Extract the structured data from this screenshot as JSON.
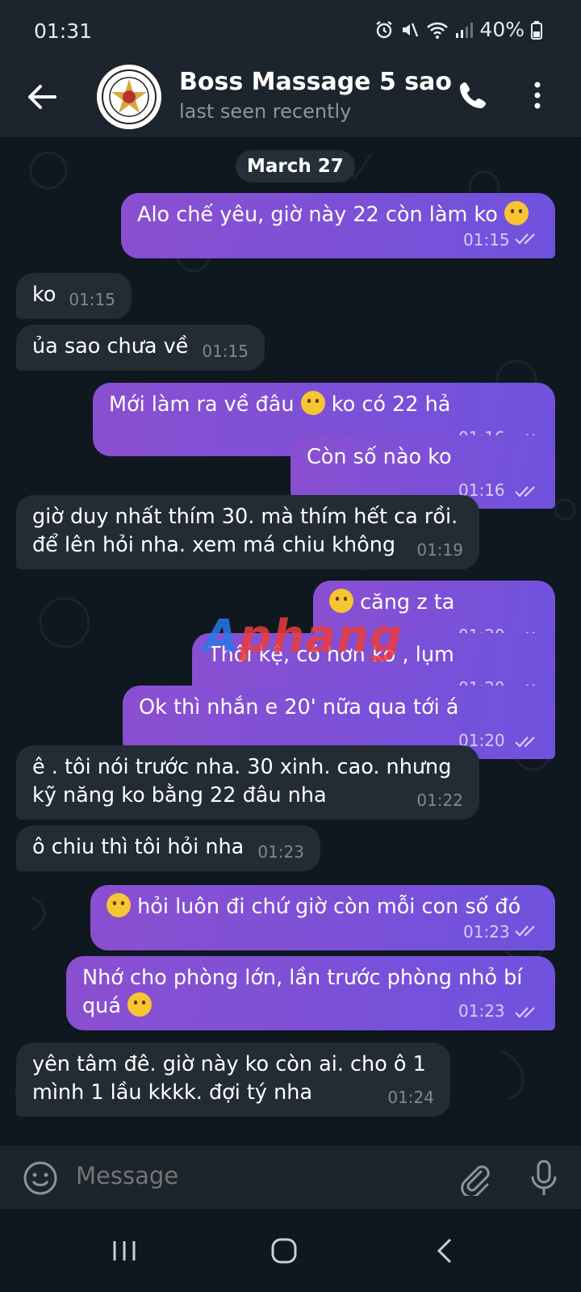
{
  "status": {
    "time": "01:31",
    "battery": "40%"
  },
  "header": {
    "title": "Boss Massage 5 sao",
    "subtitle": "last seen recently"
  },
  "chat": {
    "date": "March 27",
    "messages": [
      {
        "dir": "out",
        "text": "Alo chế yêu, giờ này 22 còn làm ko",
        "emoji": "kiss-icon",
        "time": "01:15"
      },
      {
        "dir": "in",
        "text": "ko",
        "time": "01:15"
      },
      {
        "dir": "in",
        "text": "ủa sao chưa về",
        "time": "01:15"
      },
      {
        "dir": "out",
        "text_before": "Mới làm ra về đâu",
        "emoji": "woozy-face-icon",
        "text_after": "ko có 22 hả",
        "time": "01:16"
      },
      {
        "dir": "out",
        "text": "Còn số nào ko",
        "time": "01:16"
      },
      {
        "dir": "in",
        "line1": "giờ duy nhất thím 30. mà thím hết ca rồi.",
        "line2": "để lên hỏi nha. xem má chiu không",
        "time": "01:19"
      },
      {
        "dir": "out",
        "emoji": "woozy-face-icon",
        "text": "căng z ta",
        "time": "01:20"
      },
      {
        "dir": "out",
        "text": "Thôi kệ, có hơn ko , lụm",
        "time": "01:20"
      },
      {
        "dir": "out",
        "text": "Ok thì nhắn e 20' nữa qua tới á",
        "time": "01:20"
      },
      {
        "dir": "in",
        "line1": "ê . tôi nói trước nha. 30 xinh. cao. nhưng",
        "line2": "kỹ năng ko bằng 22 đâu nha",
        "time": "01:22"
      },
      {
        "dir": "in",
        "text": "ô chiu thì tôi hỏi nha",
        "time": "01:23"
      },
      {
        "dir": "out",
        "emoji": "flushed-face-icon",
        "text": "hỏi luôn đi chứ giờ còn mỗi con số đó",
        "time": "01:23"
      },
      {
        "dir": "out",
        "line1": "Nhớ cho phòng lớn, lần trước phòng nhỏ bí",
        "line2": "quá",
        "emoji": "pleading-face-icon",
        "time": "01:23"
      },
      {
        "dir": "in",
        "line1": "yên tâm đê. giờ này ko còn ai. cho ô 1",
        "line2": "mình 1 lầu kkkk. đợi tý nha",
        "time": "01:24"
      }
    ]
  },
  "watermark": {
    "part1": "A",
    "part2": "phang"
  },
  "input": {
    "placeholder": "Message"
  },
  "colors": {
    "outgoing": "#7a50d8",
    "incoming": "#232c35",
    "background": "#0f171f",
    "bar": "#1c242d"
  }
}
